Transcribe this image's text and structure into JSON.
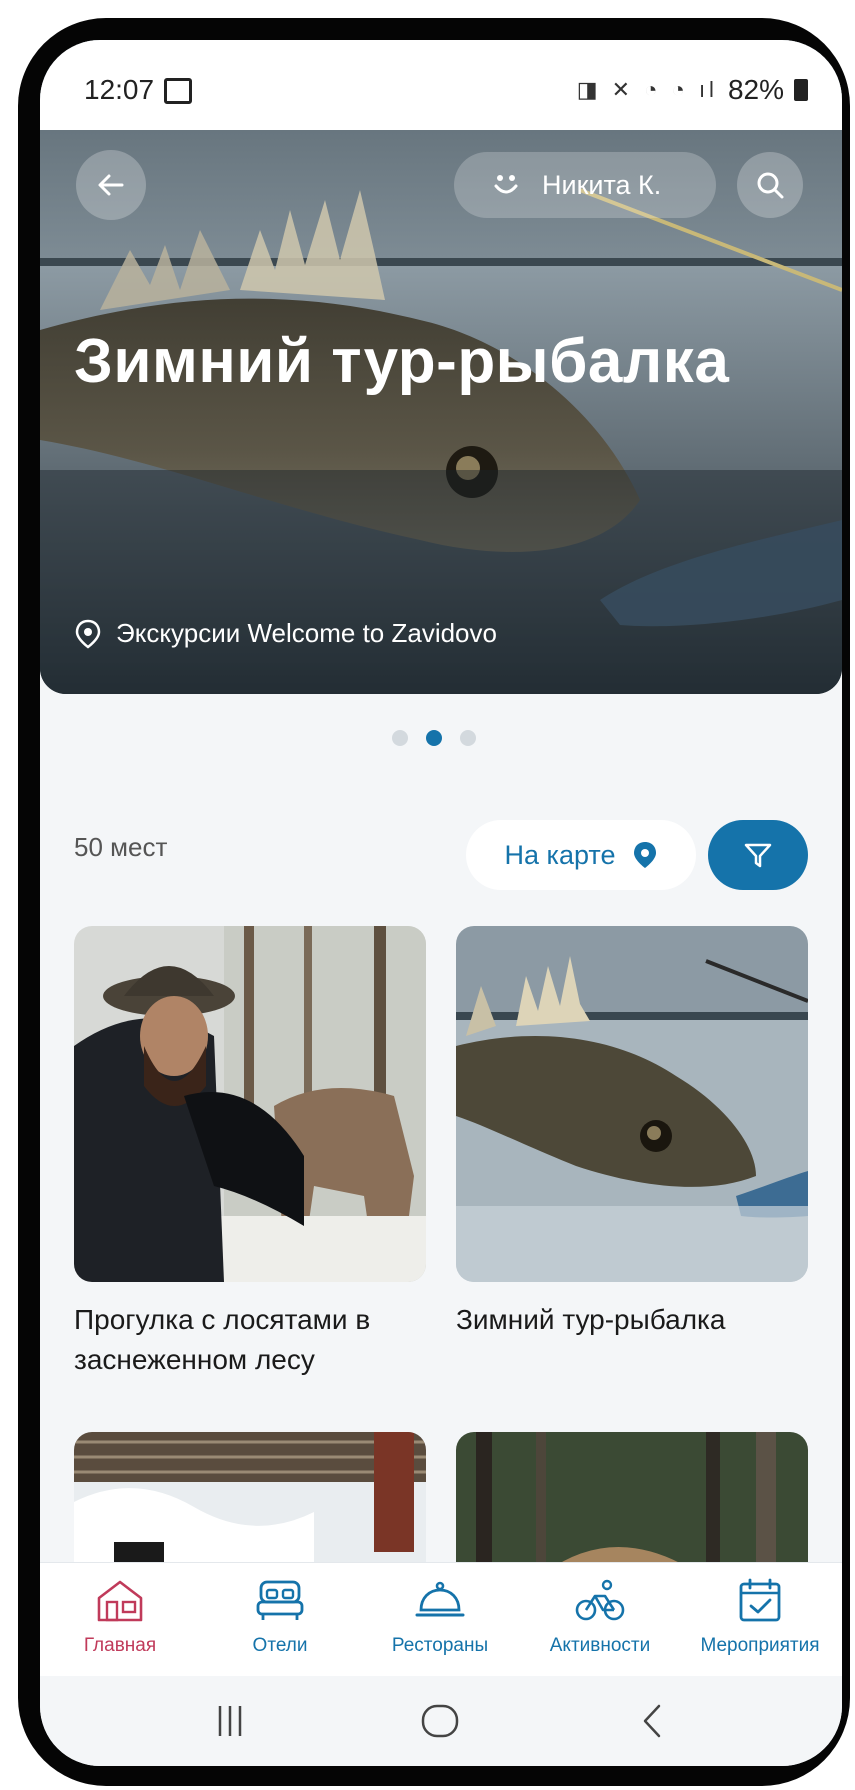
{
  "status_bar": {
    "time": "12:07",
    "battery": "82%",
    "glyphs": "◨ ✕ ◔ ◔ ıl"
  },
  "hero": {
    "title": "Зимний тур-рыбалка",
    "location": "Экскурсии Welcome to Zavidovo",
    "user_name": "Никита К.",
    "carousel": {
      "count": 3,
      "active": 1
    }
  },
  "list_header": {
    "count_text": "50 мест",
    "map_label": "На карте"
  },
  "cards": [
    {
      "title": "Прогулка с лосятами в заснеженном лесу"
    },
    {
      "title": "Зимний тур-рыбалка"
    }
  ],
  "tabbar": {
    "items": [
      {
        "label": "Главная",
        "icon": "home-icon",
        "active": true
      },
      {
        "label": "Отели",
        "icon": "bed-icon",
        "active": false
      },
      {
        "label": "Рестораны",
        "icon": "cloche-icon",
        "active": false
      },
      {
        "label": "Активности",
        "icon": "bicycle-icon",
        "active": false
      },
      {
        "label": "Мероприятия",
        "icon": "calendar-check-icon",
        "active": false
      }
    ]
  },
  "colors": {
    "accent": "#1573aa",
    "active_tab": "#c03a5a",
    "background": "#f4f6f8"
  }
}
